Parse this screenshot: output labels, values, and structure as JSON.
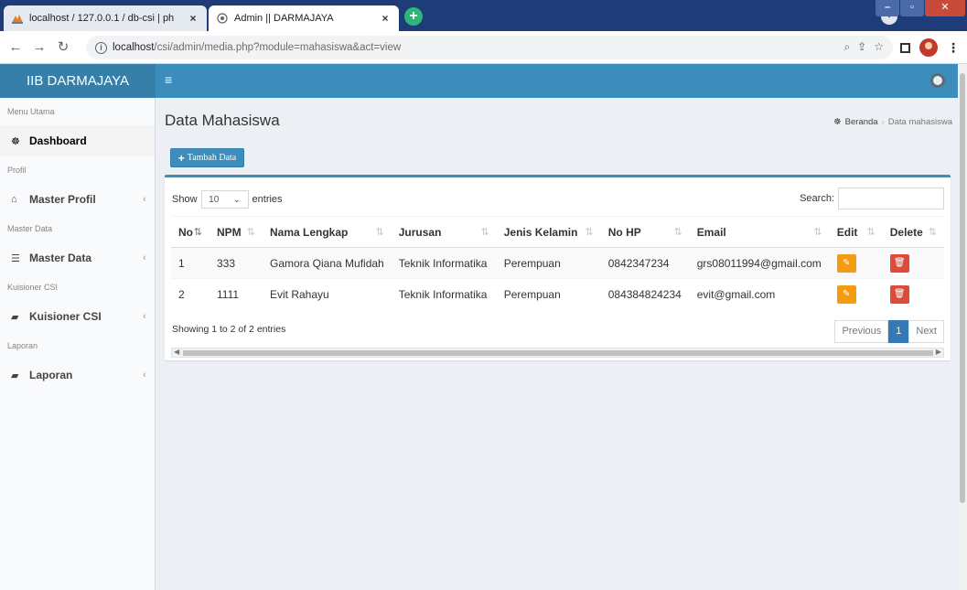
{
  "browser": {
    "tabs": [
      {
        "title": "localhost / 127.0.0.1 / db-csi | ph",
        "close": "×"
      },
      {
        "title": "Admin || DARMAJAYA",
        "close": "×"
      }
    ],
    "new_tab": "+",
    "url_host": "localhost",
    "url_path": "/csi/admin/media.php?module=mahasiswa&act=view"
  },
  "app": {
    "logo": "IIB DARMAJAYA",
    "accent_color": "#3c8dbc"
  },
  "sidebar": {
    "sections": [
      {
        "header": "Menu Utama",
        "item": {
          "label": "Dashboard",
          "icon": "dashboard-icon",
          "has_chevron": false
        }
      },
      {
        "header": "Profil",
        "item": {
          "label": "Master Profil",
          "icon": "home-icon",
          "has_chevron": true
        }
      },
      {
        "header": "Master Data",
        "item": {
          "label": "Master Data",
          "icon": "database-icon",
          "has_chevron": true
        }
      },
      {
        "header": "Kuisioner CSI",
        "item": {
          "label": "Kuisioner CSI",
          "icon": "book-icon",
          "has_chevron": true
        }
      },
      {
        "header": "Laporan",
        "item": {
          "label": "Laporan",
          "icon": "book-icon",
          "has_chevron": true
        }
      }
    ],
    "chevron": "‹"
  },
  "content": {
    "title": "Data Mahasiswa",
    "breadcrumb": {
      "home": "Beranda",
      "current": "Data mahasiswa"
    },
    "add_button": "Tambah Data"
  },
  "table": {
    "length_show": "Show",
    "length_value": "10",
    "length_entries": "entries",
    "search_label": "Search:",
    "search_value": "",
    "columns": [
      "No",
      "NPM",
      "Nama Lengkap",
      "Jurusan",
      "Jenis Kelamin",
      "No HP",
      "Email",
      "Edit",
      "Delete"
    ],
    "rows": [
      {
        "no": "1",
        "npm": "333",
        "nama": "Gamora Qiana Mufidah",
        "jurusan": "Teknik Informatika",
        "jk": "Perempuan",
        "hp": "0842347234",
        "email": "grs08011994@gmail.com"
      },
      {
        "no": "2",
        "npm": "1111",
        "nama": "Evit Rahayu",
        "jurusan": "Teknik Informatika",
        "jk": "Perempuan",
        "hp": "084384824234",
        "email": "evit@gmail.com"
      }
    ],
    "info": "Showing 1 to 2 of 2 entries",
    "pagination": {
      "previous": "Previous",
      "page": "1",
      "next": "Next"
    }
  }
}
